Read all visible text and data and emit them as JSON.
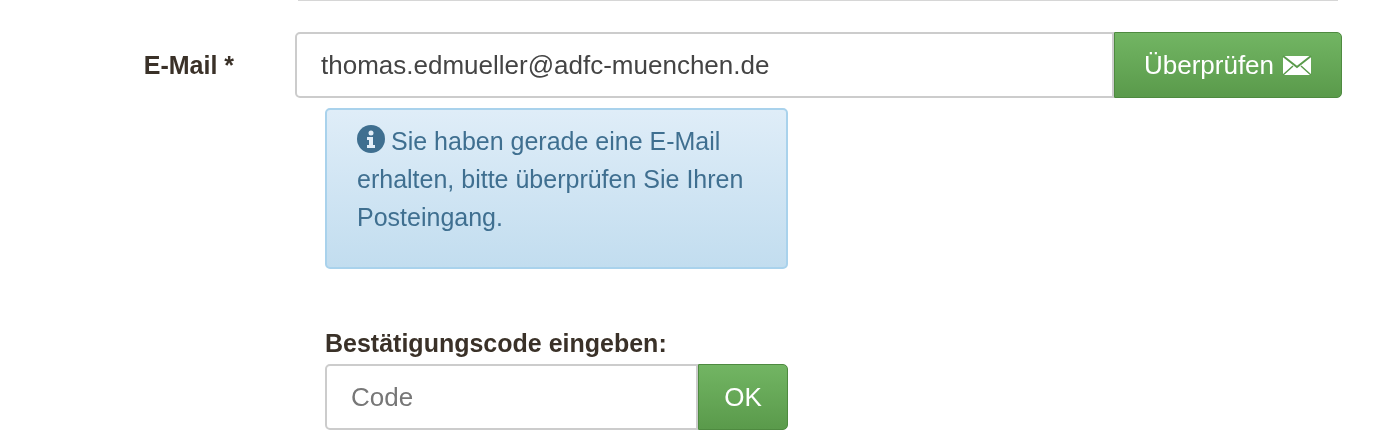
{
  "email_field": {
    "label": "E-Mail *",
    "value": "thomas.edmueller@adfc-muenchen.de"
  },
  "verify_button": {
    "label": "Überprüfen"
  },
  "info_alert": {
    "text": "Sie haben gerade eine E-Mail erhalten, bitte überprüfen Sie Ihren Posteingang."
  },
  "code_field": {
    "label": "Bestätigungscode eingeben:",
    "placeholder": "Code"
  },
  "ok_button": {
    "label": "OK"
  }
}
